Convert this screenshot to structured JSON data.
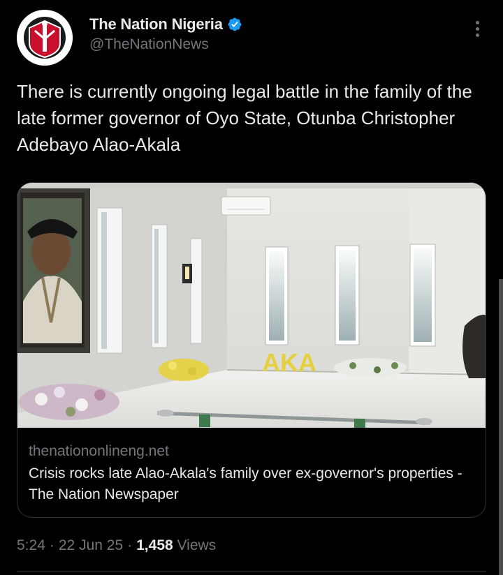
{
  "account": {
    "display_name": "The Nation Nigeria",
    "handle": "@TheNationNews",
    "verified_color": "#1d9bf0"
  },
  "tweet": {
    "text": "There is currently ongoing legal battle in the family of the late former governor of Oyo State, Otunba Christopher Adebayo Alao-Akala"
  },
  "card": {
    "domain": "thenationonlineng.net",
    "title": "Crisis rocks late Alao-Akala's family over ex-governor's properties - The Nation Newspaper",
    "image_text": "AKA"
  },
  "meta": {
    "time": "5:24",
    "separator": "·",
    "date": "22 Jun 25",
    "views_count": "1,458",
    "views_label": "Views"
  }
}
